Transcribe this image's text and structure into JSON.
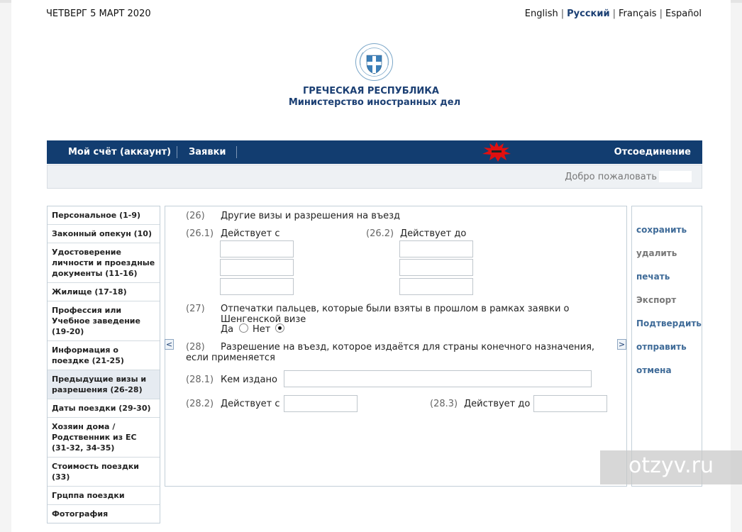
{
  "header": {
    "date": "ЧЕТВЕРГ 5 МАРТ 2020",
    "languages": [
      "English",
      "Русский",
      "Français",
      "Español"
    ],
    "active_language": "Русский",
    "republic": "ГРЕЧЕСКАЯ РЕСПУБЛИКА",
    "ministry": "Министерство иностранных дел"
  },
  "nav": {
    "account": "Мой счёт (аккаунт)",
    "applications": "Заявки",
    "logout": "Отсоединение"
  },
  "welcome": "Добро пожаловать",
  "sidebar": {
    "items": [
      {
        "label": "Персональное (1-9)"
      },
      {
        "label": "Законный опекун (10)"
      },
      {
        "label": "Удостоверение личности и проездные документы (11-16)"
      },
      {
        "label": "Жилище (17-18)"
      },
      {
        "label": "Профессия или Учебное заведение (19-20)"
      },
      {
        "label": "Информация о поездке (21-25)"
      },
      {
        "label": "Предыдущие визы и разрешения (26-28)"
      },
      {
        "label": "Даты поездки (29-30)"
      },
      {
        "label": "Хозяин дома / Родственник из ЕС (31-32, 34-35)"
      },
      {
        "label": "Стоимость поездки (33)"
      },
      {
        "label": "Грцппа поездки"
      },
      {
        "label": "Фотография"
      }
    ],
    "active_index": 6
  },
  "form": {
    "q26": {
      "num": "(26)",
      "label": "Другие визы и разрешения на въезд"
    },
    "q26_1": {
      "num": "(26.1)",
      "label": "Действует с"
    },
    "q26_2": {
      "num": "(26.2)",
      "label": "Действует до"
    },
    "q27": {
      "num": "(27)",
      "label": "Отпечатки пальцев, которые были взяты в прошлом в рамках заявки о Шенгенской визе"
    },
    "q27_yes": "Да",
    "q27_no": "Нет",
    "q27_selected": "Нет",
    "q28": {
      "num": "(28)",
      "label": "Разрешение на въезд, которое издаётся для страны конечного назначения, если применяется"
    },
    "q28_1": {
      "num": "(28.1)",
      "label": "Кем издано",
      "value": ""
    },
    "q28_2": {
      "num": "(28.2)",
      "label": "Действует с",
      "value": ""
    },
    "q28_3": {
      "num": "(28.3)",
      "label": "Действует до",
      "value": ""
    },
    "prev": "<",
    "next": ">"
  },
  "actions": [
    {
      "label": "сохранить",
      "enabled": true
    },
    {
      "label": "удалить",
      "enabled": false
    },
    {
      "label": "печать",
      "enabled": true
    },
    {
      "label": "Экспорт",
      "enabled": false
    },
    {
      "label": "Подтвердить",
      "enabled": true
    },
    {
      "label": "отправить",
      "enabled": true
    },
    {
      "label": "отмена",
      "enabled": true
    }
  ],
  "watermark": "otzyv.ru",
  "colors": {
    "nav_bg": "#123d70",
    "brand_text": "#1b3f73",
    "link": "#3f6b98"
  }
}
